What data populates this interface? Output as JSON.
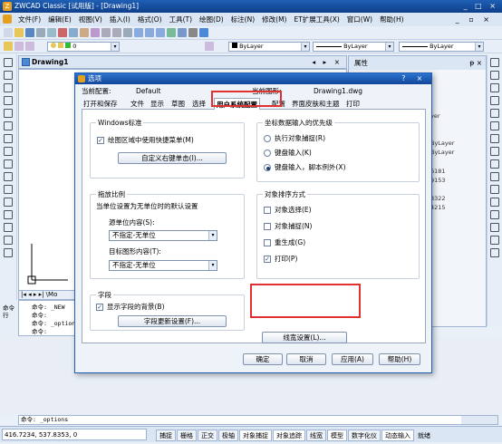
{
  "app": {
    "title": "ZWCAD Classic [试用版] - [Drawing1]",
    "window_controls": "_ □ ×"
  },
  "menu": {
    "items": [
      "文件(F)",
      "编辑(E)",
      "视图(V)",
      "插入(I)",
      "格式(O)",
      "工具(T)",
      "绘图(D)",
      "标注(N)",
      "修改(M)",
      "ET扩展工具(X)",
      "窗口(W)",
      "帮助(H)"
    ],
    "mdi_controls": "_ ▫ ×"
  },
  "toolbar2": {
    "layer_value": "0",
    "color_value": "ByLayer",
    "linetype_value": "ByLayer",
    "lineweight_value": "ByLayer"
  },
  "drawing_tab": {
    "label": "Drawing1",
    "controls": "◂ ▸ ×"
  },
  "properties": {
    "title": "属性",
    "pin": "ᵽ ×",
    "values": [
      "yer",
      "ByLayer",
      "ByLayer",
      "6181",
      "9153",
      "3322",
      "4215"
    ]
  },
  "layout_tabs": {
    "text": "|◂ ◂ ▸ ▸| \\Mo"
  },
  "command": {
    "history": [
      "命令: _NEW",
      "命令:",
      "命令: _options",
      "命令:",
      "命令:"
    ],
    "side_label": "命令行",
    "current": "命令: _options"
  },
  "status": {
    "coords": "416.7234, 537.8353, 0",
    "buttons": [
      "捕捉",
      "栅格",
      "正交",
      "极轴",
      "对象捕捉",
      "对象追踪",
      "线宽",
      "模型",
      "数字化仪",
      "动态输入",
      "就绪"
    ]
  },
  "dialog": {
    "title": "选项",
    "controls": "? ×",
    "current_config_label": "当前配置:",
    "current_config_value": "Default",
    "current_drawing_label": "当前图形:",
    "current_drawing_value": "Drawing1.dwg",
    "tabs": [
      "打开和保存",
      "文件",
      "显示",
      "草图",
      "选择",
      "用户系统配置",
      "配置",
      "界面皮肤和主题",
      "打印"
    ],
    "active_tab": "用户系统配置",
    "windows_group": {
      "title": "Windows标准",
      "shortcut_menu_label": "绘图区域中使用快捷菜单(M)",
      "shortcut_menu_checked": true,
      "right_click_button": "自定义右键单击(I)..."
    },
    "coord_group": {
      "title": "坐标数据输入的优先级",
      "options": [
        "执行对象捕捉(R)",
        "键盘输入(K)",
        "键盘输入，脚本例外(X)"
      ],
      "selected": 2
    },
    "scale_group": {
      "title": "拖放比例",
      "description": "当单位设置为无单位时的默认设置",
      "source_label": "源单位内容(S):",
      "source_value": "不指定-无单位",
      "target_label": "目标图形内容(T):",
      "target_value": "不指定-无单位"
    },
    "sort_group": {
      "title": "对象排序方式",
      "options": [
        {
          "label": "对象选择(E)",
          "checked": false
        },
        {
          "label": "对象捕捉(N)",
          "checked": false
        },
        {
          "label": "重生成(G)",
          "checked": false
        },
        {
          "label": "打印(P)",
          "checked": true
        }
      ]
    },
    "field_group": {
      "title": "字段",
      "background_label": "显示字段的背景(B)",
      "background_checked": true,
      "update_button": "字段更新设置(F)..."
    },
    "lineweight_button": "线宽设置(L)...",
    "buttons": {
      "ok": "确定",
      "cancel": "取消",
      "apply": "应用(A)",
      "help": "帮助(H)"
    }
  }
}
